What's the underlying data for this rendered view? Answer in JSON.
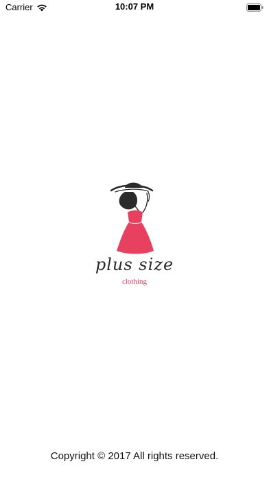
{
  "status_bar": {
    "carrier": "Carrier",
    "time": "10:07 PM",
    "icons": [
      "wifi-icon",
      "battery-icon"
    ]
  },
  "logo": {
    "wordmark": "plus size",
    "subtitle": "clothing",
    "colors": {
      "dress": "#E8405F",
      "ink": "#2B2B2B"
    }
  },
  "footer": {
    "copyright": "Copyright © 2017 All rights reserved."
  }
}
